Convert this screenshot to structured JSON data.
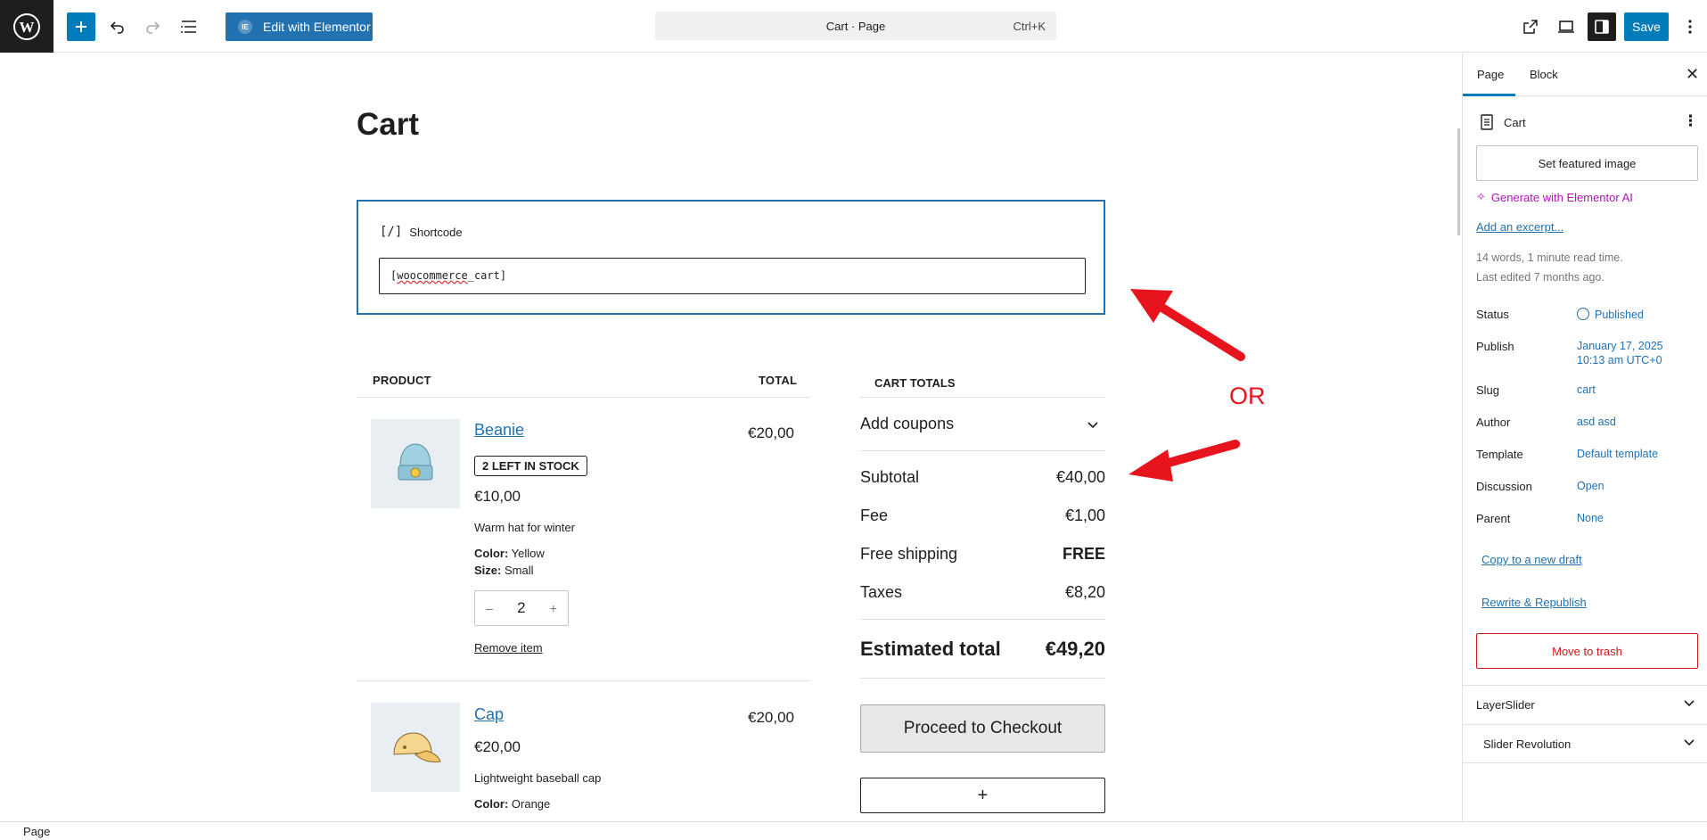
{
  "toolbar": {
    "elementor_label": "Edit with Elementor",
    "elementor_badge": "IE",
    "command_title": "Cart · Page",
    "command_shortcut": "Ctrl+K",
    "save_label": "Save"
  },
  "page": {
    "title": "Cart",
    "shortcode_label": "Shortcode",
    "shortcode_icon": "[/]",
    "shortcode_value_prefix": "[",
    "shortcode_value_misspelled": "woocommerce",
    "shortcode_value_suffix": "_cart]"
  },
  "cart": {
    "col_product": "PRODUCT",
    "col_total": "TOTAL",
    "items": [
      {
        "name": "Beanie",
        "stock": "2 LEFT IN STOCK",
        "price": "€10,00",
        "description": "Warm hat for winter",
        "color_label": "Color:",
        "color": "Yellow",
        "size_label": "Size:",
        "size": "Small",
        "quantity": "2",
        "remove": "Remove item",
        "total": "€20,00"
      },
      {
        "name": "Cap",
        "price": "€20,00",
        "description": "Lightweight baseball cap",
        "color_label": "Color:",
        "color": "Orange",
        "total": "€20,00"
      }
    ]
  },
  "totals": {
    "title": "CART TOTALS",
    "coupons": "Add coupons",
    "subtotal_label": "Subtotal",
    "subtotal": "€40,00",
    "fee_label": "Fee",
    "fee": "€1,00",
    "shipping_label": "Free shipping",
    "shipping": "FREE",
    "taxes_label": "Taxes",
    "taxes": "€8,20",
    "estimated_label": "Estimated total",
    "estimated": "€49,20",
    "checkout": "Proceed to Checkout",
    "add_block": "+"
  },
  "annotation": {
    "or_text": "OR",
    "arrow_color": "#e8141d"
  },
  "sidebar": {
    "tab_page": "Page",
    "tab_block": "Block",
    "doc_title": "Cart",
    "featured_image": "Set featured image",
    "generate_ai": "Generate with Elementor AI",
    "excerpt": "Add an excerpt...",
    "word_count": "14 words, 1 minute read time.",
    "last_edited": "Last edited 7 months ago.",
    "props": [
      {
        "label": "Status",
        "value": "Published"
      },
      {
        "label": "Publish",
        "value": "January 17, 2025",
        "value2": "10:13 am UTC+0"
      },
      {
        "label": "Slug",
        "value": "cart"
      },
      {
        "label": "Author",
        "value": "asd asd"
      },
      {
        "label": "Template",
        "value": "Default template"
      },
      {
        "label": "Discussion",
        "value": "Open"
      },
      {
        "label": "Parent",
        "value": "None"
      }
    ],
    "copy_draft": "Copy to a new draft",
    "rewrite": "Rewrite & Republish",
    "trash": "Move to trash",
    "panels": [
      "LayerSlider",
      "Slider Revolution"
    ]
  },
  "footer": {
    "breadcrumb": "Page"
  },
  "colors": {
    "accent": "#007cba",
    "link": "#2271b1",
    "danger": "#cc1818",
    "ai": "#b113b4"
  }
}
